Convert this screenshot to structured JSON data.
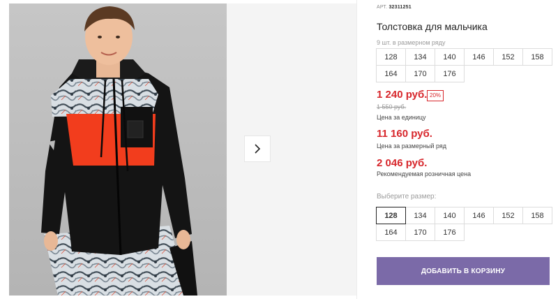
{
  "product": {
    "article_label": "АРТ.",
    "article_number": "32311251",
    "title": "Толстовка для мальчика",
    "range_caption": "9 шт. в размерном ряду"
  },
  "range_sizes": [
    "128",
    "134",
    "140",
    "146",
    "152",
    "158",
    "164",
    "170",
    "176"
  ],
  "prices": {
    "unit_price": "1 240 руб.",
    "discount_badge": "20%",
    "old_price": "1 550 руб.",
    "unit_caption": "Цена за единицу",
    "range_price": "11 160 руб.",
    "range_caption": "Цена за размерный ряд",
    "retail_price": "2 046 руб.",
    "retail_caption": "Рекомендуемая розничная цена"
  },
  "size_select": {
    "caption": "Выберите размер:",
    "options": [
      "128",
      "134",
      "140",
      "146",
      "152",
      "158",
      "164",
      "170",
      "176"
    ],
    "selected": "128"
  },
  "cart": {
    "button_label": "ДОБАВИТЬ В КОРЗИНУ"
  },
  "colors": {
    "price_red": "#d7262b",
    "button_purple": "#7b6aa8"
  },
  "icons": {
    "next_arrow": "chevron-right-icon"
  }
}
